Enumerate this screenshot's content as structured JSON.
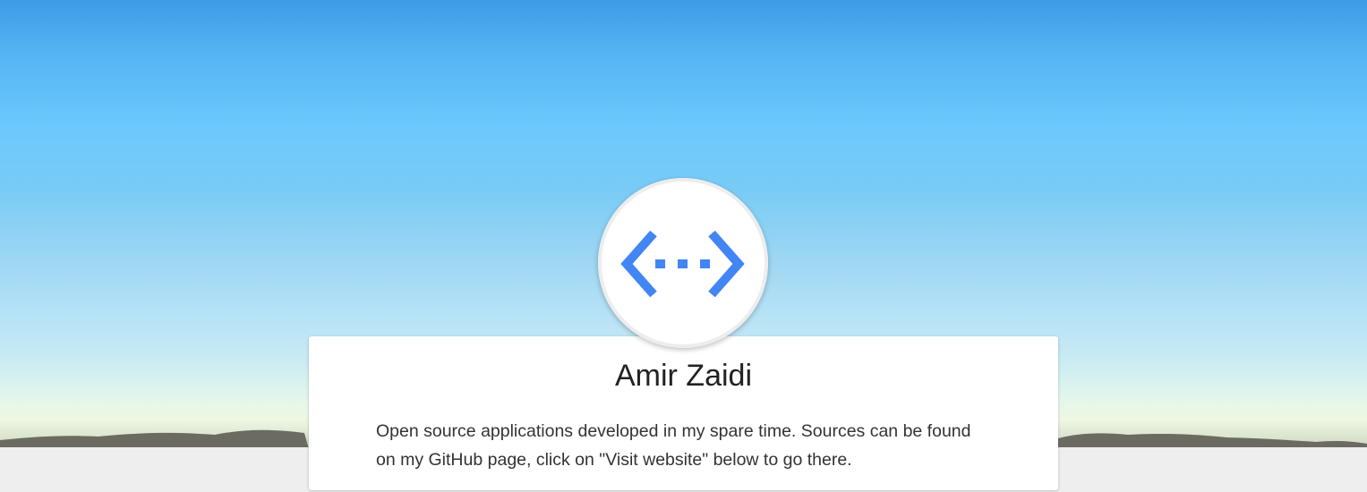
{
  "profile": {
    "name": "Amir Zaidi",
    "description": "Open source applications developed in my spare time. Sources can be found on my GitHub page, click on \"Visit website\" below to go there.",
    "avatar_icon": "code-brackets-icon",
    "avatar_color": "#4285f4"
  },
  "theme": {
    "sky_top": "#3d9be6",
    "sky_horizon": "#e6f7ea",
    "page_background": "#eeeeee",
    "card_background": "#ffffff"
  }
}
